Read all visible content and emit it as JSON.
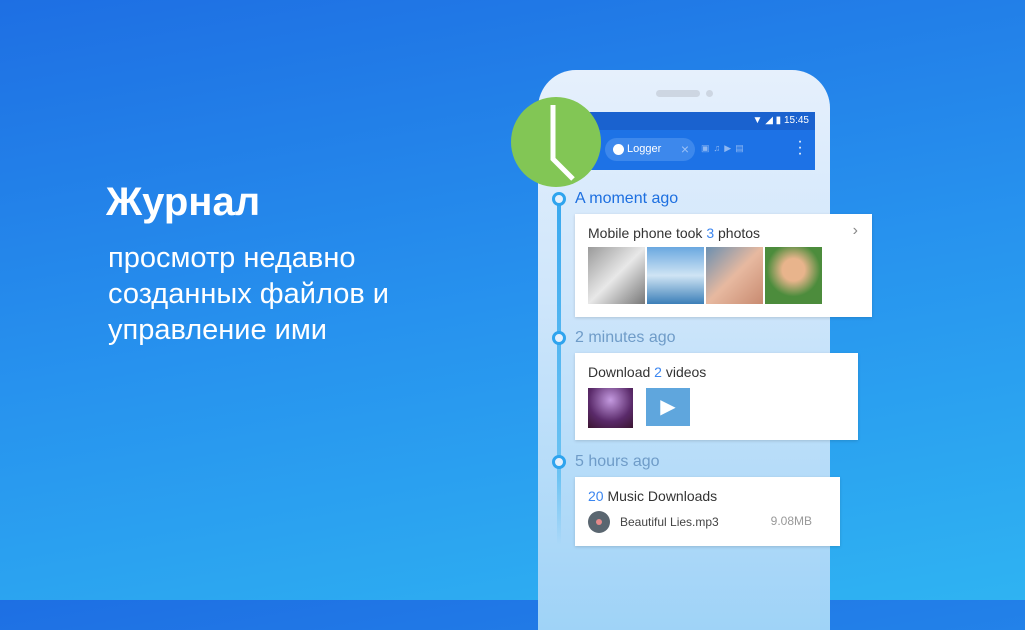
{
  "promo": {
    "title": "Журнал",
    "subtitle": "просмотр недавно созданных файлов и управление ими"
  },
  "status_bar": {
    "time": "15:45"
  },
  "toolbar": {
    "chip_label": "Logger",
    "menu": "⋮",
    "icons": [
      "image-icon",
      "music-icon",
      "video-icon",
      "document-icon"
    ]
  },
  "timeline": [
    {
      "label": "A moment ago",
      "prefix": "Mobile phone took ",
      "count": "3",
      "suffix": " photos"
    },
    {
      "label": "2 minutes ago",
      "prefix": "Download ",
      "count": "2",
      "suffix": " videos"
    },
    {
      "label": "5 hours ago",
      "count": "20",
      "suffix": " Music Downloads",
      "file": "Beautiful Lies.mp3",
      "size": "9.08MB"
    }
  ],
  "colors": {
    "accent": "#1d72e6",
    "clock": "#82c655",
    "highlight": "#3b86f0"
  }
}
